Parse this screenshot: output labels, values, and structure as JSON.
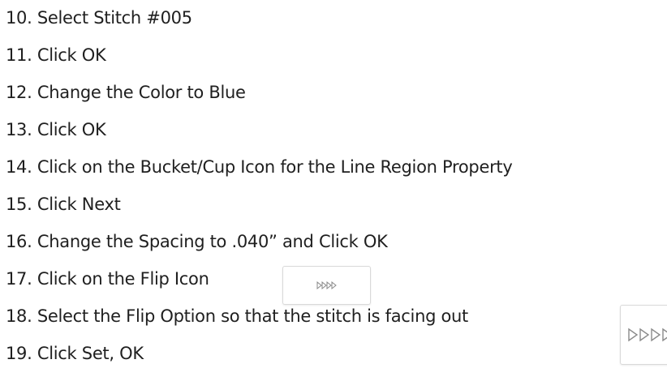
{
  "steps": [
    {
      "text": "10. Select Stitch #005"
    },
    {
      "text": "11. Click OK"
    },
    {
      "text": "12. Change the Color to Blue"
    },
    {
      "text": "13. Click OK"
    },
    {
      "text": "14. Click on the Bucket/Cup Icon for the Line Region Property"
    },
    {
      "text": "15. Click Next"
    },
    {
      "text": "16. Change the Spacing to .040” and Click OK"
    },
    {
      "text": "17. Click on the Flip Icon"
    },
    {
      "text": "18. Select the Flip Option so that the stitch is facing out"
    },
    {
      "text": "19. Click Set, OK"
    }
  ],
  "icons": {
    "flip_icon_small": "flip-triangles-icon",
    "flip_option_icon": "flip-triangles-icon"
  },
  "colors": {
    "text": "#1f1f1f",
    "icon_stroke": "#8a8a8a",
    "icon_border": "#d9d9d9"
  }
}
